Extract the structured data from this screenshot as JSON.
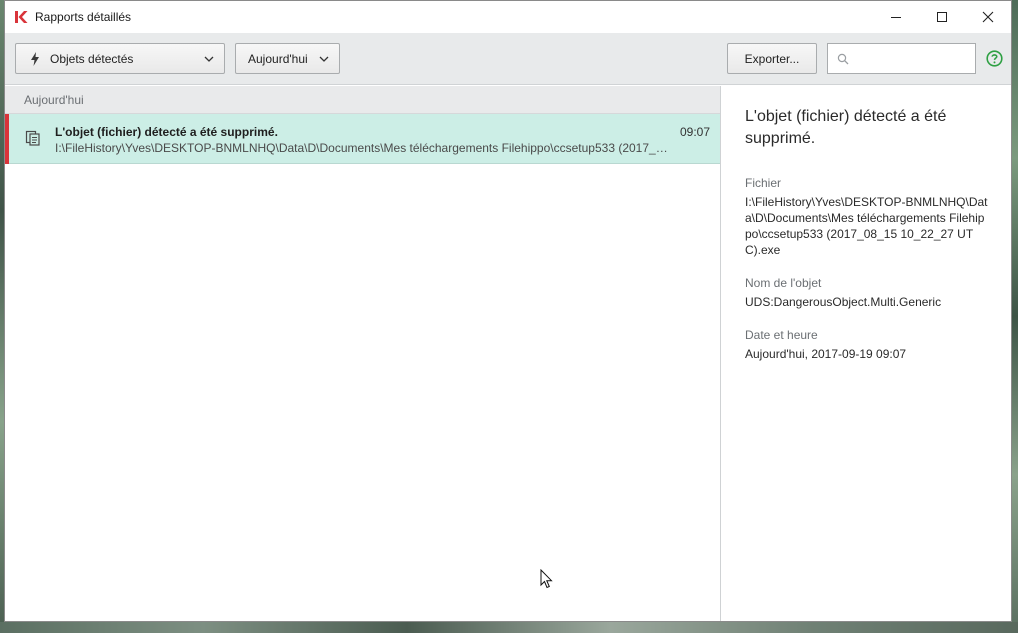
{
  "window": {
    "title": "Rapports détaillés",
    "brand_color": "#d9343a"
  },
  "toolbar": {
    "filter_dropdown": "Objets détectés",
    "date_dropdown": "Aujourd'hui",
    "export_label": "Exporter...",
    "search_placeholder": "",
    "icons": {
      "filter": "bolt-icon",
      "search": "search-icon",
      "help": "help-icon"
    },
    "help_color": "#2ea043"
  },
  "list": {
    "group_header": "Aujourd'hui",
    "rows": [
      {
        "title": "L'objet (fichier) détecté a été supprimé.",
        "path": "I:\\FileHistory\\Yves\\DESKTOP-BNMLNHQ\\Data\\D\\Documents\\Mes téléchargements Filehippo\\ccsetup533 (2017_08...",
        "time": "09:07",
        "icon": "files-icon",
        "selected": true,
        "severity_color": "#d9343a"
      }
    ]
  },
  "detail": {
    "title": "L'objet (fichier) détecté a été supprimé.",
    "fields": [
      {
        "label": "Fichier",
        "value": "I:\\FileHistory\\Yves\\DESKTOP-BNMLNHQ\\Data\\D\\Documents\\Mes téléchargements Filehippo\\ccsetup533 (2017_08_15 10_22_27 UTC).exe"
      },
      {
        "label": "Nom de l'objet",
        "value": "UDS:DangerousObject.Multi.Generic"
      },
      {
        "label": "Date et heure",
        "value": "Aujourd'hui, 2017-09-19 09:07"
      }
    ]
  }
}
